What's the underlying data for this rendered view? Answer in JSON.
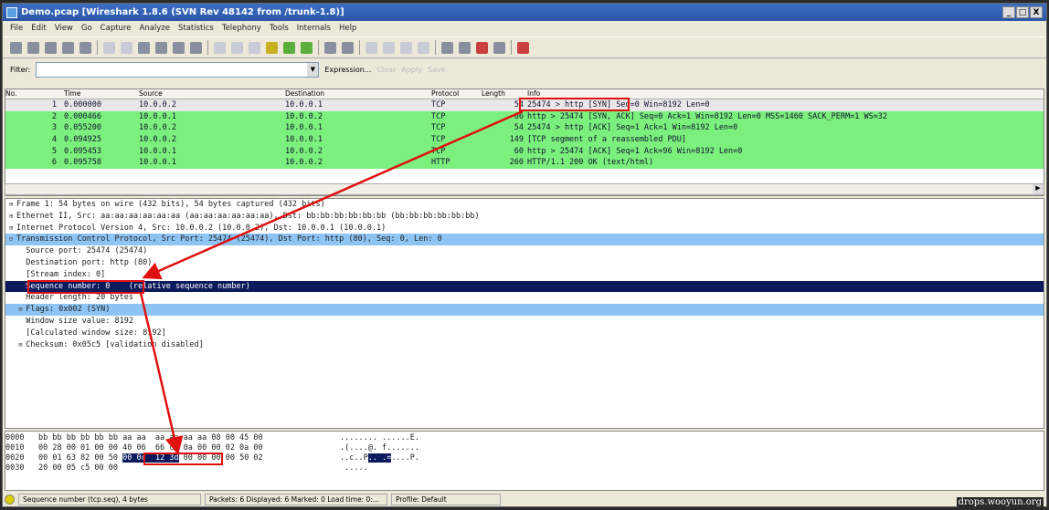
{
  "window": {
    "title": "Demo.pcap  [Wireshark 1.8.6  (SVN Rev 48142 from /trunk-1.8)]",
    "controls": [
      "_",
      "□",
      "X"
    ]
  },
  "menu": [
    "File",
    "Edit",
    "View",
    "Go",
    "Capture",
    "Analyze",
    "Statistics",
    "Telephony",
    "Tools",
    "Internals",
    "Help"
  ],
  "filter": {
    "label": "Filter:",
    "value": "",
    "expression": "Expression...",
    "clear": "Clear",
    "apply": "Apply",
    "save": "Save"
  },
  "packet_list": {
    "columns": [
      "No.",
      "Time",
      "Source",
      "Destination",
      "Protocol",
      "Length",
      "Info"
    ],
    "rows": [
      {
        "no": "1",
        "time": "0.000000",
        "src": "10.0.0.2",
        "dst": "10.0.0.1",
        "proto": "TCP",
        "len": "54",
        "info": "25474 > http [SYN] Seq=0 Win=8192 Len=0",
        "selected": true
      },
      {
        "no": "2",
        "time": "0.000466",
        "src": "10.0.0.1",
        "dst": "10.0.0.2",
        "proto": "TCP",
        "len": "66",
        "info": "http > 25474 [SYN, ACK] Seq=0 Ack=1 Win=8192 Len=0 MSS=1460 SACK_PERM=1 WS=32"
      },
      {
        "no": "3",
        "time": "0.055200",
        "src": "10.0.0.2",
        "dst": "10.0.0.1",
        "proto": "TCP",
        "len": "54",
        "info": "25474 > http [ACK] Seq=1 Ack=1 Win=8192 Len=0"
      },
      {
        "no": "4",
        "time": "0.094925",
        "src": "10.0.0.2",
        "dst": "10.0.0.1",
        "proto": "TCP",
        "len": "149",
        "info": "[TCP segment of a reassembled PDU]"
      },
      {
        "no": "5",
        "time": "0.095453",
        "src": "10.0.0.1",
        "dst": "10.0.0.2",
        "proto": "TCP",
        "len": "60",
        "info": "http > 25474 [ACK] Seq=1 Ack=96 Win=8192 Len=0"
      },
      {
        "no": "6",
        "time": "0.095758",
        "src": "10.0.0.1",
        "dst": "10.0.0.2",
        "proto": "HTTP",
        "len": "260",
        "info": "HTTP/1.1 200 OK  (text/html)"
      }
    ]
  },
  "details": [
    {
      "text": "Frame 1: 54 bytes on wire (432 bits), 54 bytes captured (432 bits)",
      "exp": "+"
    },
    {
      "text": "Ethernet II, Src: aa:aa:aa:aa:aa:aa (aa:aa:aa:aa:aa:aa), Dst: bb:bb:bb:bb:bb:bb (bb:bb:bb:bb:bb:bb)",
      "exp": "+"
    },
    {
      "text": "Internet Protocol Version 4, Src: 10.0.0.2 (10.0.0.2), Dst: 10.0.0.1 (10.0.0.1)",
      "exp": "+"
    },
    {
      "text": "Transmission Control Protocol, Src Port: 25474 (25474), Dst Port: http (80), Seq: 0, Len: 0",
      "exp": "-",
      "style": "hl"
    },
    {
      "text": "  Source port: 25474 (25474)"
    },
    {
      "text": "  Destination port: http (80)"
    },
    {
      "text": "  [Stream index: 0]"
    },
    {
      "text": "  Sequence number: 0    (relative sequence number)",
      "style": "sel"
    },
    {
      "text": "  Header length: 20 bytes"
    },
    {
      "text": "Flags: 0x002 (SYN)",
      "exp": "+",
      "indent": true,
      "style": "hl"
    },
    {
      "text": "  Window size value: 8192"
    },
    {
      "text": "  [Calculated window size: 8192]"
    },
    {
      "text": "Checksum: 0x05c5 [validation disabled]",
      "exp": "+",
      "indent": true
    }
  ],
  "hex": [
    {
      "off": "0000",
      "pre": "bb bb bb bb bb bb aa aa  aa aa aa aa 08 00 45 00",
      "sel": "",
      "post": "",
      "ascii_pre": "........ ......E.",
      "ascii_sel": "",
      "ascii_post": ""
    },
    {
      "off": "0010",
      "pre": "00 28 00 01 00 00 40 06  66 cd 0a 00 00 02 0a 00",
      "sel": "",
      "post": "",
      "ascii_pre": ".(....@. f.......",
      "ascii_sel": "",
      "ascii_post": ""
    },
    {
      "off": "0020",
      "pre": "00 01 63 82 00 50 ",
      "sel": "00 0c  12 3d",
      "post": " 00 00 00 00 50 02",
      "ascii_pre": "..c..P",
      "ascii_sel": ".. .=",
      "ascii_post": "....P."
    },
    {
      "off": "0030",
      "pre": "20 00 05 c5 00 00",
      "sel": "",
      "post": "",
      "ascii_pre": " .....",
      "ascii_sel": "",
      "ascii_post": ""
    }
  ],
  "status": {
    "field": "Sequence number (tcp.seq), 4 bytes",
    "packets": "Packets: 6 Displayed: 6 Marked: 0 Load time: 0:...",
    "profile": "Profile: Default"
  },
  "watermark": "drops.wooyun.org",
  "colors": {
    "title": "#2a56a8",
    "tcp_row": "#7cf07c",
    "highlight": "#8ec4f4",
    "selected": "#0c1a5c",
    "annotation": "#e01010"
  }
}
